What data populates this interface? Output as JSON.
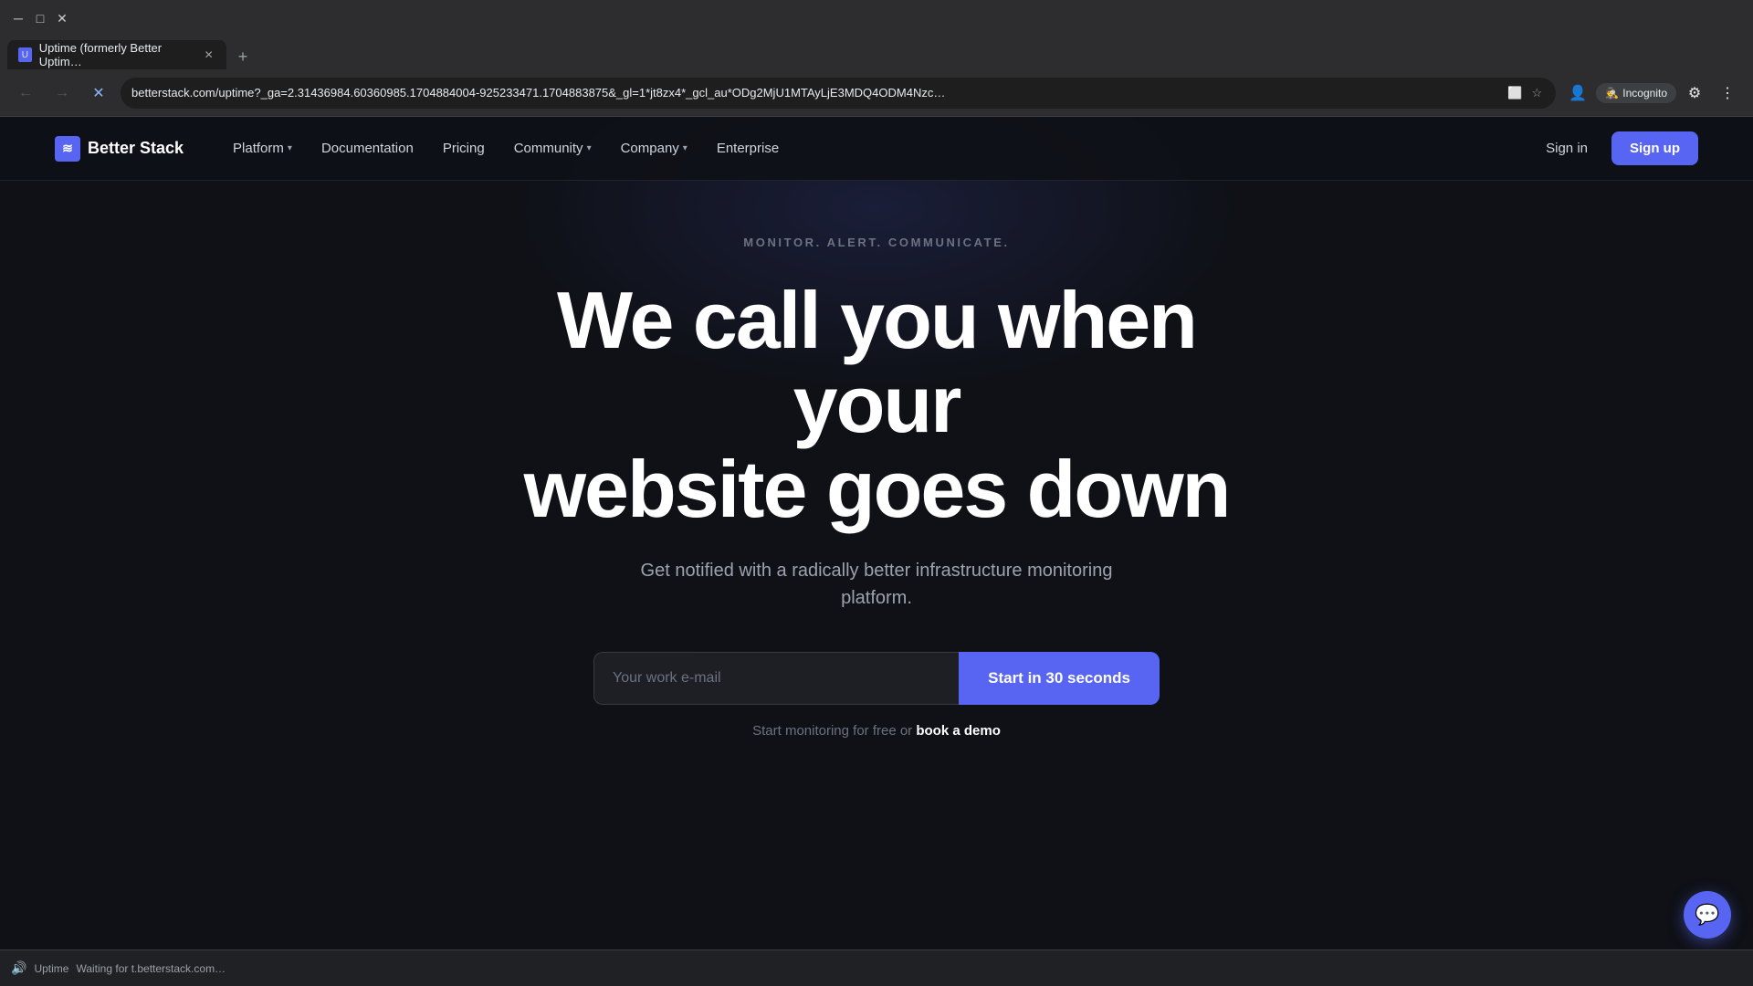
{
  "browser": {
    "tab": {
      "title": "Uptime (formerly Better Uptim…",
      "favicon": "U"
    },
    "new_tab_label": "+",
    "address": "betterstack.com/uptime?_ga=2.31436984.60360985.1704884004-925233471.1704883875&_gl=1*jt8zx4*_gcl_au*ODg2MjU1MTAyLjE3MDQ4ODM4Nzc…",
    "nav_buttons": {
      "back": "←",
      "forward": "→",
      "reload": "✕",
      "home": "⌂"
    },
    "toolbar_icons": {
      "screen_cast": "⬜",
      "bookmark": "☆",
      "profile": "👤",
      "incognito": "Incognito",
      "extensions": "⚙",
      "menu": "⋮"
    }
  },
  "navbar": {
    "logo": {
      "text": "Better Stack",
      "icon": "≋"
    },
    "links": [
      {
        "label": "Platform",
        "hasDropdown": true
      },
      {
        "label": "Documentation",
        "hasDropdown": false
      },
      {
        "label": "Pricing",
        "hasDropdown": false
      },
      {
        "label": "Community",
        "hasDropdown": true
      },
      {
        "label": "Company",
        "hasDropdown": true
      },
      {
        "label": "Enterprise",
        "hasDropdown": false
      }
    ],
    "signin_label": "Sign in",
    "signup_label": "Sign up"
  },
  "hero": {
    "eyebrow": "MONITOR. ALERT. COMMUNICATE.",
    "title_line1": "We call you when your",
    "title_line2": "website goes down",
    "subtitle": "Get notified with a radically better infrastructure monitoring platform.",
    "email_placeholder": "Your work e-mail",
    "cta_button": "Start in 30 seconds",
    "footnote_text": "Start monitoring for free or ",
    "footnote_link": "book a demo"
  },
  "bottom_bar": {
    "status_text": "Waiting for t.betterstack.com…",
    "tab_label": "Uptime"
  },
  "chat_widget": {
    "icon": "💬"
  }
}
